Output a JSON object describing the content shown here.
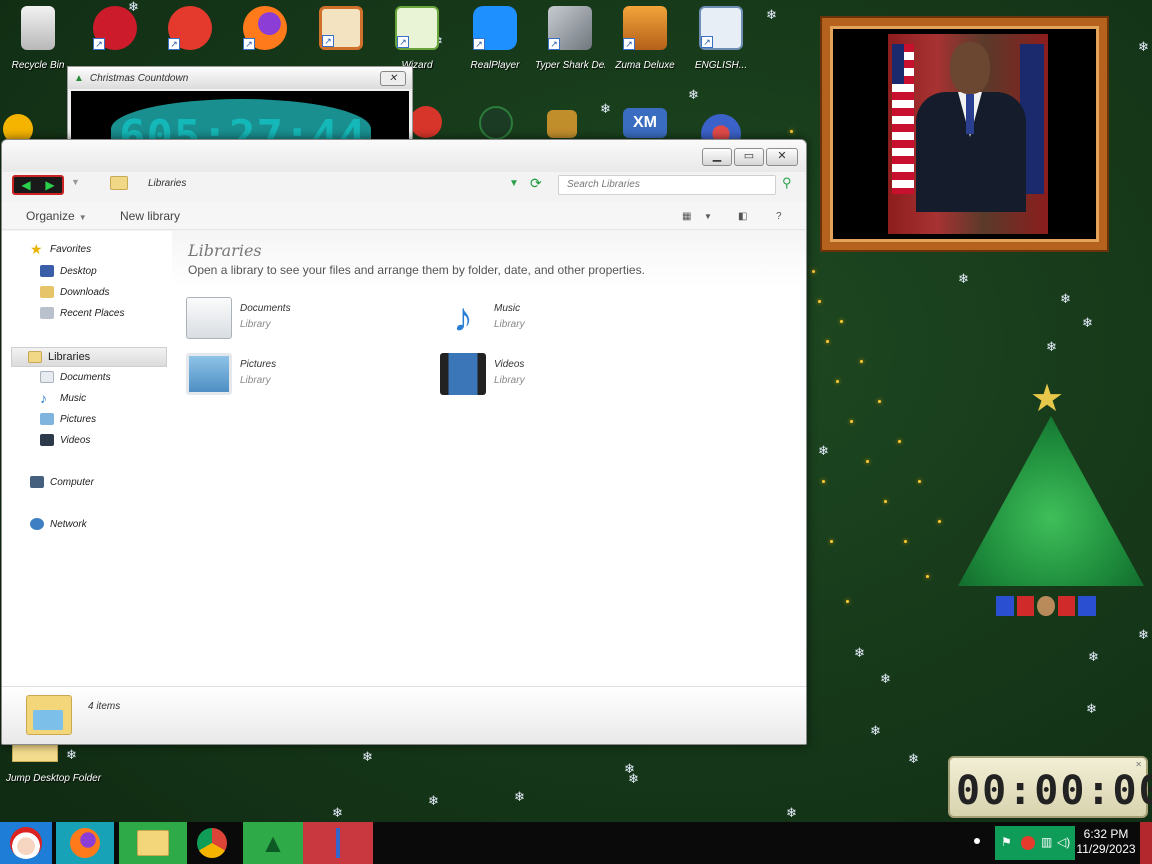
{
  "desktop": {
    "icons_row1": [
      {
        "label": "Recycle Bin",
        "color": "#d9d9d9"
      },
      {
        "label": "",
        "color": "#cc1b2b"
      },
      {
        "label": "",
        "color": "#e43a2e"
      },
      {
        "label": "",
        "color": "#ff7a1a"
      },
      {
        "label": "",
        "color": "#d1702a"
      },
      {
        "label": "Wizard",
        "color": "#6aa53b"
      },
      {
        "label": "RealPlayer",
        "color": "#1e90ff"
      },
      {
        "label": "Typer Shark Deluxe",
        "color": "#9aa0a6"
      },
      {
        "label": "Zuma Deluxe",
        "color": "#e8891b"
      },
      {
        "label": "ENGLISH...",
        "color": "#6e8fb3"
      }
    ],
    "icons_row2": [
      {
        "label": "",
        "color": "#f5b400"
      },
      {
        "label": "",
        "color": "#d7352a"
      },
      {
        "label": "",
        "color": "#2c7d3b"
      },
      {
        "label": "",
        "color": "#c18e2c"
      },
      {
        "label": "XM",
        "color": "#3a6cc0"
      },
      {
        "label": "",
        "color": "#3b62c9"
      }
    ],
    "desk_folder_label": "Jump Desktop Folder"
  },
  "countdown": {
    "title": "Christmas Countdown",
    "value": "605:27:44"
  },
  "timer": {
    "value": "00:00:00"
  },
  "explorer": {
    "breadcrumb": "Libraries",
    "search_placeholder": "Search Libraries",
    "toolbar": {
      "organize": "Organize",
      "new_library": "New library",
      "help": "?"
    },
    "nav": {
      "favorites": "Favorites",
      "fav_items": [
        "Desktop",
        "Downloads",
        "Recent Places"
      ],
      "libraries": "Libraries",
      "lib_items": [
        "Documents",
        "Music",
        "Pictures",
        "Videos"
      ],
      "computer": "Computer",
      "network": "Network"
    },
    "content": {
      "title": "Libraries",
      "description": "Open a library to see your files and arrange them by folder, date, and other properties.",
      "items": [
        {
          "name": "Documents",
          "type": "Library"
        },
        {
          "name": "Music",
          "type": "Library"
        },
        {
          "name": "Pictures",
          "type": "Library"
        },
        {
          "name": "Videos",
          "type": "Library"
        }
      ]
    },
    "details": {
      "text": "4 items"
    }
  },
  "taskbar": {
    "time": "6:32 PM",
    "date": "11/29/2023"
  }
}
